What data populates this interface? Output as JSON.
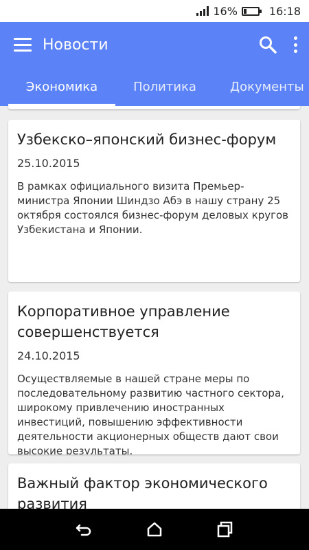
{
  "status_bar": {
    "battery": "16%",
    "time": "16:18"
  },
  "app_bar": {
    "title": "Новости",
    "color": "#5b82f6"
  },
  "tabs": [
    {
      "label": "Экономика",
      "active": true
    },
    {
      "label": "Политика",
      "active": false
    },
    {
      "label": "Документы",
      "active": false
    }
  ],
  "news": [
    {
      "title": "Узбекско–японский бизнес-форум",
      "date": "25.10.2015",
      "text": "В рамках официального визита Премьер-министра Японии Шиндзо Абэ в нашу страну 25 октября состоялся бизнес-форум деловых кругов Узбекистана и Японии."
    },
    {
      "title": "Корпоративное управление совершенствуется",
      "date": "24.10.2015",
      "text": "Осуществляемые в нашей стране меры по последовательному развитию частного сектора, широкому привлечению иностранных инвестиций, повышению эффективности деятельности акционерных обществ дают свои высокие результаты."
    },
    {
      "title": "Важный фактор экономического развития",
      "date": "",
      "text": ""
    }
  ],
  "icons": {
    "menu": "menu-icon",
    "search": "search-icon",
    "more": "more-vert-icon",
    "back": "back-icon",
    "home": "home-icon",
    "recents": "recents-icon"
  }
}
